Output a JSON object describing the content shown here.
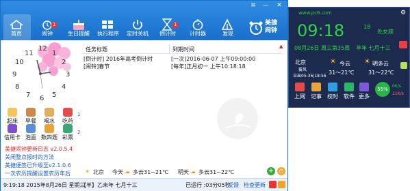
{
  "toolbar": {
    "items": [
      {
        "label": "首页"
      },
      {
        "label": "闹钟"
      },
      {
        "label": "生日提醒"
      },
      {
        "label": "执行程序"
      },
      {
        "label": "定时关机"
      },
      {
        "label": "倒计时"
      },
      {
        "label": "计时器"
      },
      {
        "label": "发现"
      }
    ],
    "alarm_badge": "1",
    "countdown_badge": "1",
    "brand": "美捷闹钟"
  },
  "clock_numbers": [
    "11",
    "12",
    "1",
    "10",
    "2",
    "9",
    "3",
    "8",
    "4",
    "7",
    "6",
    "5"
  ],
  "quick": {
    "items": [
      {
        "label": "起床"
      },
      {
        "label": "早餐"
      },
      {
        "label": "喝水"
      },
      {
        "label": "吃药"
      },
      {
        "label": "信用卡"
      },
      {
        "label": "泡面"
      },
      {
        "label": "数四题"
      },
      {
        "label": "彩票"
      }
    ],
    "page_up": "1",
    "page_down": "2"
  },
  "news": [
    {
      "text": "美捷闹钟更新日志 v2.0.5.4",
      "color": "#e02828"
    },
    {
      "text": "关闭整点报时的方法",
      "color": "#1a5fcc"
    },
    {
      "text": "美捷便签已升级至v2.1.0.6",
      "color": "#1a5fcc"
    },
    {
      "text": "一次农历提醒设置农历年后",
      "color": "#1a5fcc"
    }
  ],
  "tasks": {
    "col_title": "任务标题",
    "col_time": "到期时间",
    "rows": [
      {
        "title": "[倒计时] 2016年高考倒计时",
        "time": "[一次]2016-06-07 上午09:00:00"
      },
      {
        "title": "[闹铃]春节",
        "time": "[每年]正月初一 上午10:18:18"
      }
    ]
  },
  "weather_bar": {
    "city": "北京",
    "today_label": "今天",
    "today": "多云31~21℃",
    "tomorrow_label": "明天",
    "tomorrow": "多云31~22℃"
  },
  "status": {
    "left": "9:19:18 2015年8月26日 星期三",
    "lunar": "【羊】乙未年 七月十三",
    "uptime": "已运行 :03分05秒",
    "feedback": "反馈",
    "update": "检查更新"
  },
  "widget": {
    "site": "www.pc6.com",
    "time": "09:18",
    "seconds": "18",
    "holiday": "处女座",
    "date": "08月26日 周三第35周",
    "lunar": "羊年 七月十三",
    "city": "北京",
    "city_sub": "雾风",
    "sunrise": "日出05:36|18:56",
    "today_label": "今云",
    "today_temp": "31～21℃",
    "tomorrow_label": "明多云",
    "tomorrow_temp": "31～22℃",
    "buttons": [
      {
        "label": "上网"
      },
      {
        "label": "记事"
      },
      {
        "label": "校时"
      },
      {
        "label": "软件"
      },
      {
        "label": "更多"
      }
    ],
    "percent": "55%",
    "net_up": "0K/s",
    "net_down": "11K/s"
  }
}
